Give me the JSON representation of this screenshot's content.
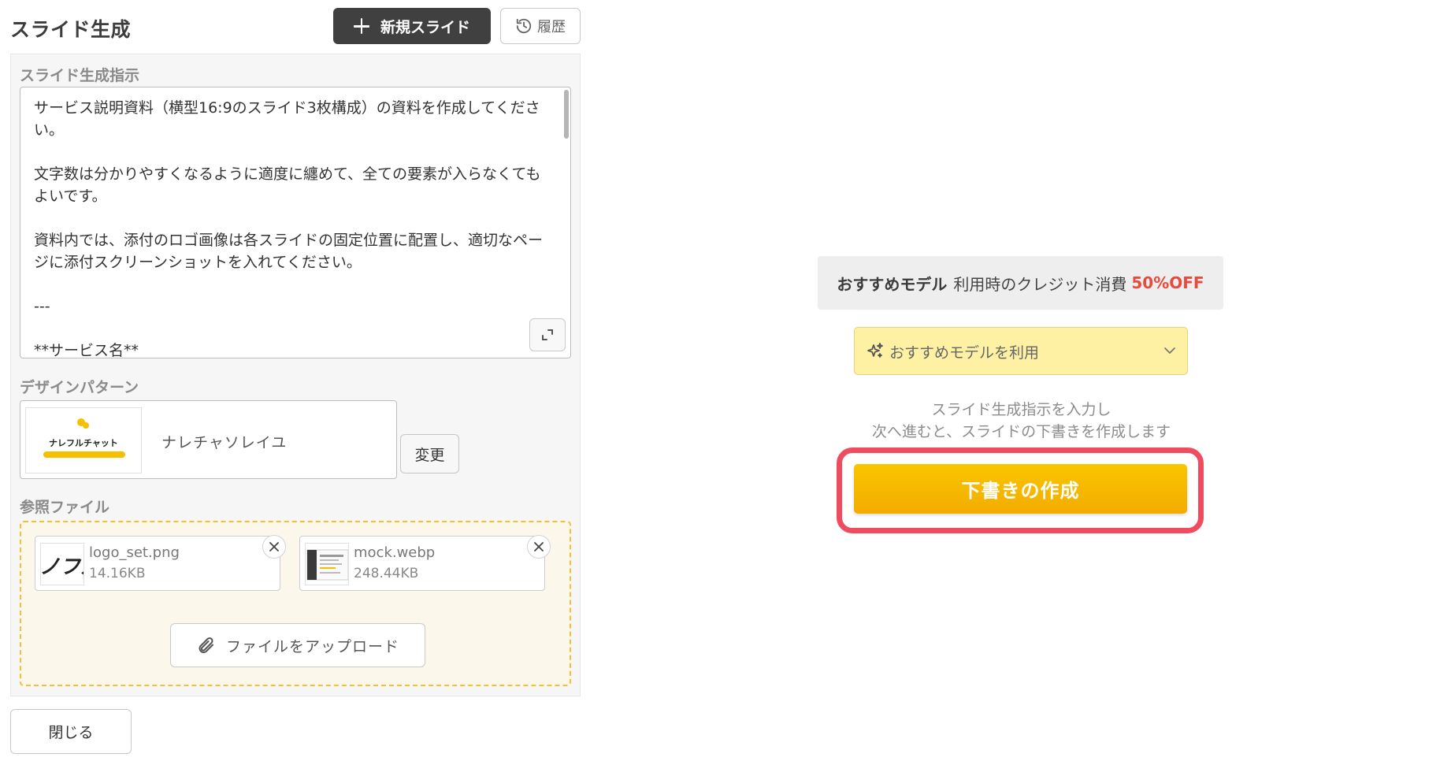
{
  "header": {
    "title": "スライド生成",
    "new_slide_label": "新規スライド",
    "history_label": "履歴"
  },
  "instructions": {
    "label": "スライド生成指示",
    "text": "サービス説明資料（横型16:9のスライド3枚構成）の資料を作成してください。\n\n文字数は分かりやすくなるように適度に纏めて、全ての要素が入らなくてもよいです。\n\n資料内では、添付のロゴ画像は各スライドの固定位置に配置し、適切なページに添付スクリーンショットを入れてください。\n\n---\n\n**サービス名**"
  },
  "design": {
    "label": "デザインパターン",
    "name": "ナレチャソレイユ",
    "thumbnail_caption": "ナレフルチャット",
    "change_label": "変更"
  },
  "reference_files": {
    "label": "参照ファイル",
    "files": [
      {
        "name": "logo_set.png",
        "size": "14.16KB",
        "thumb_text": "ノフル"
      },
      {
        "name": "mock.webp",
        "size": "248.44KB"
      }
    ],
    "upload_label": "ファイルをアップロード"
  },
  "footer": {
    "close_label": "閉じる"
  },
  "promo": {
    "strong": "おすすめモデル",
    "middle": "利用時のクレジット消費",
    "off": "50%OFF",
    "off_color": "#e84a3c"
  },
  "model_select": {
    "value": "おすすめモデルを利用"
  },
  "hint": {
    "line1": "スライド生成指示を入力し",
    "line2": "次へ進むと、スライドの下書きを作成します"
  },
  "cta": {
    "label": "下書きの作成",
    "accent": "#f5b800",
    "highlight": "#ef4d5f"
  }
}
